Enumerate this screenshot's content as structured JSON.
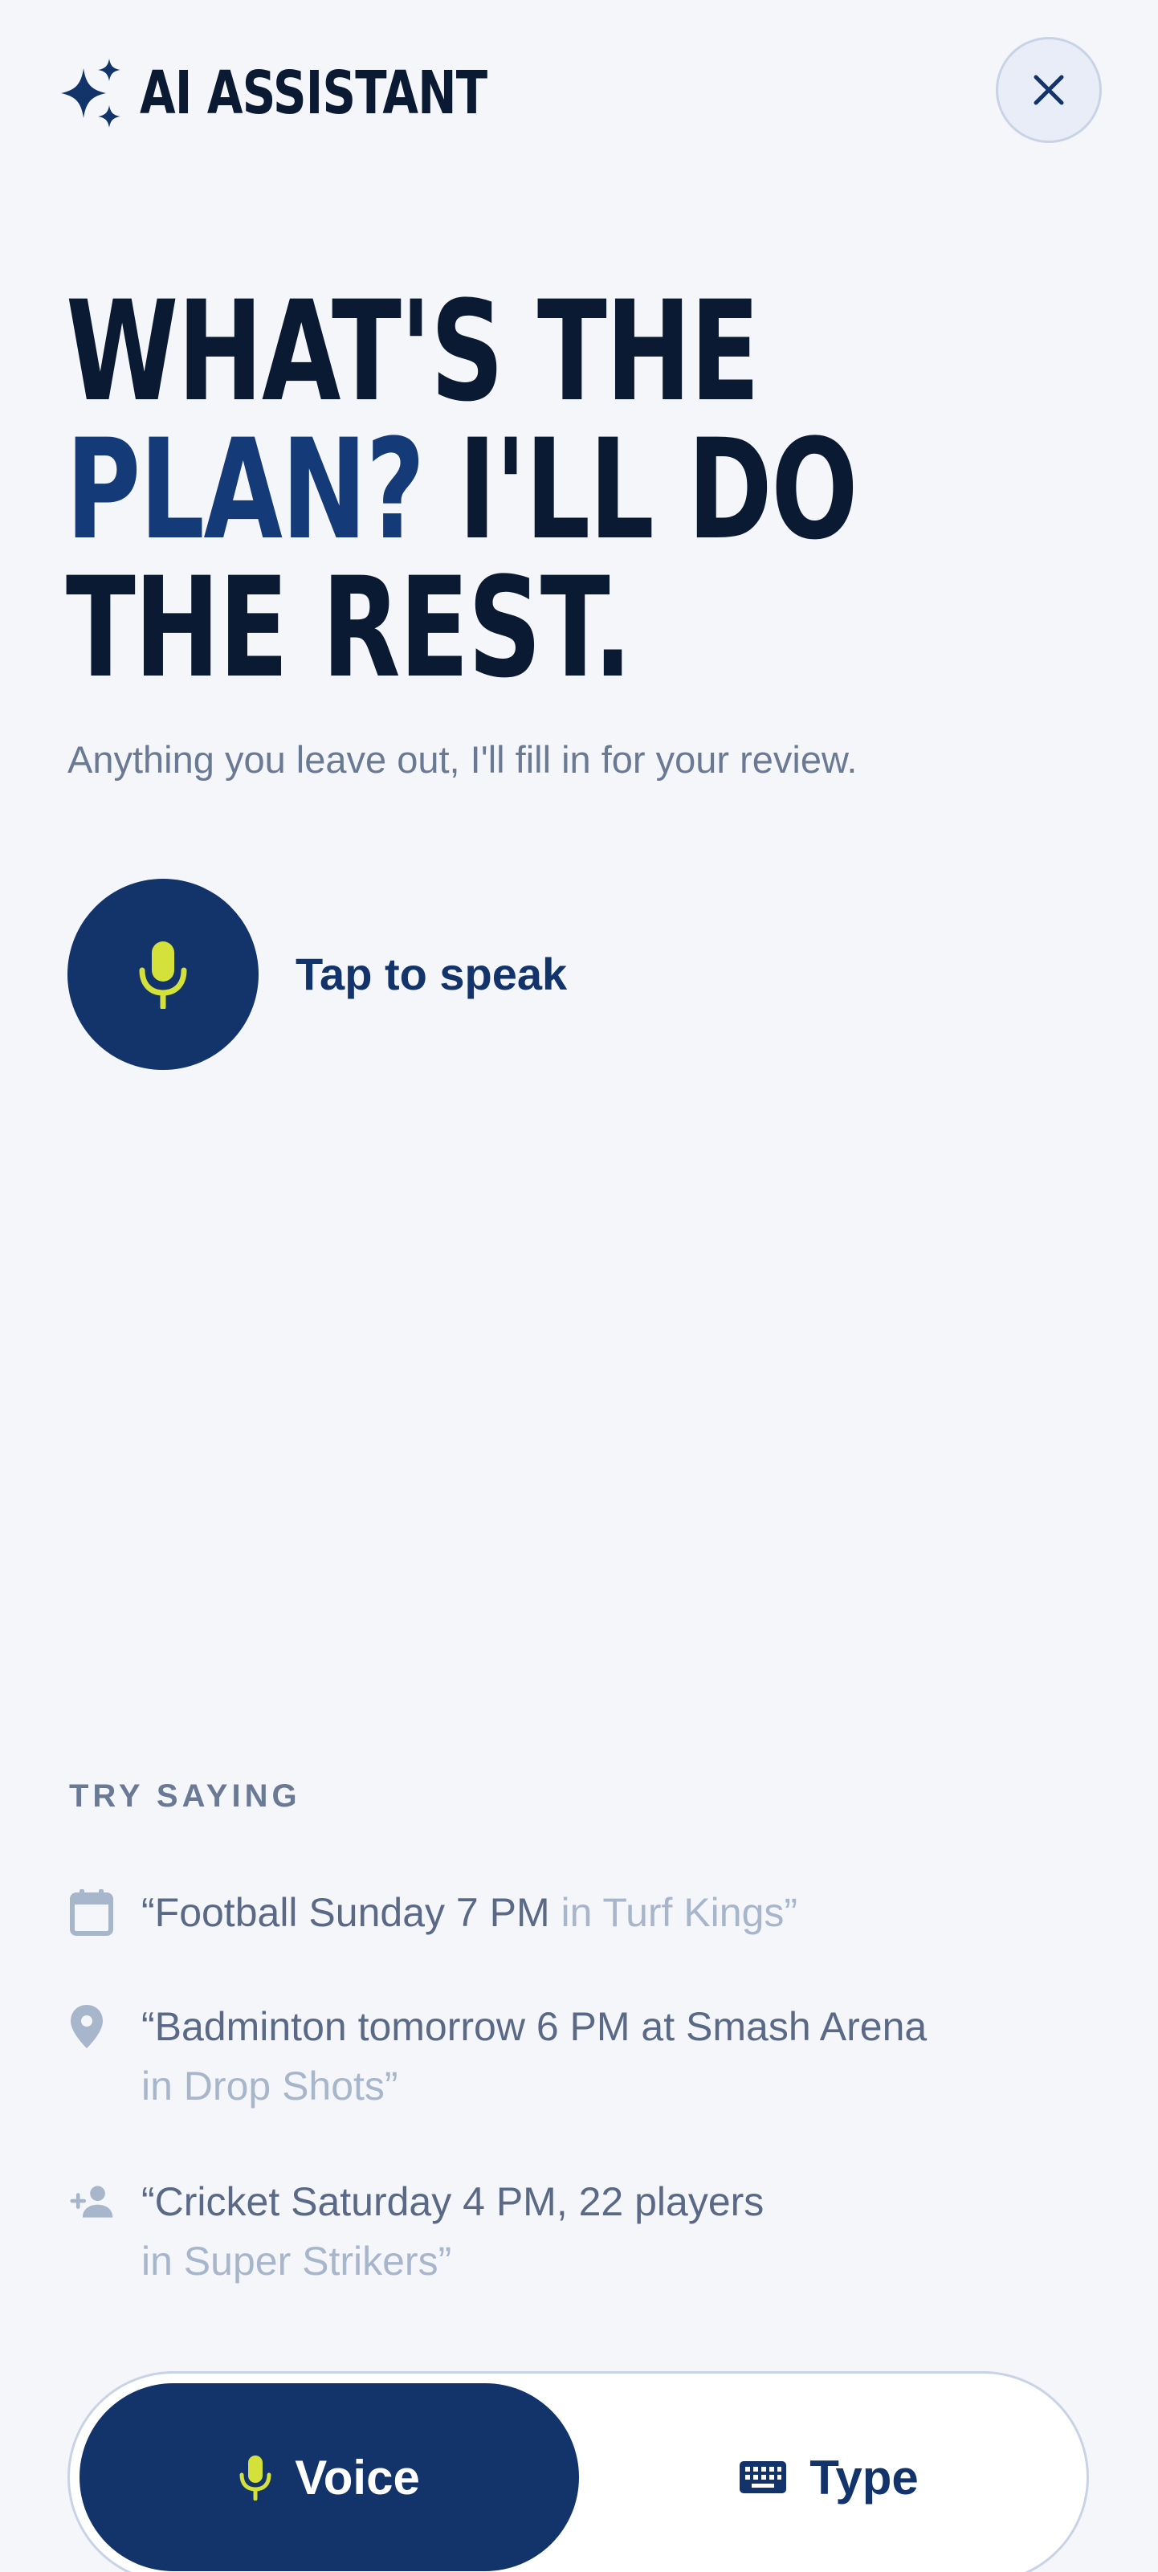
{
  "header": {
    "title": "AI ASSISTANT",
    "sparkle_icon": "sparkle-icon",
    "close_icon": "close-icon"
  },
  "hero": {
    "line1": "WHAT'S THE",
    "line2_accent": "PLAN?",
    "line2_rest": " I'LL DO",
    "line3": "THE REST.",
    "subtitle": "Anything you leave out, I'll fill in for your review."
  },
  "speak": {
    "label": "Tap to speak",
    "icon": "microphone-icon"
  },
  "try_saying": {
    "heading": "TRY SAYING",
    "examples": [
      {
        "icon": "calendar-icon",
        "main": "“Football Sunday 7 PM",
        "muted": " in Turf Kings”"
      },
      {
        "icon": "location-pin-icon",
        "main": "“Badminton tomorrow 6 PM at Smash Arena",
        "muted": "in Drop Shots”"
      },
      {
        "icon": "add-person-icon",
        "main": "“Cricket Saturday 4 PM, 22 players",
        "muted": "in Super Strikers”"
      }
    ]
  },
  "mode_toggle": {
    "voice_label": "Voice",
    "type_label": "Type",
    "selected": "Voice"
  },
  "colors": {
    "background": "#f4f6fa",
    "navy": "#12346b",
    "headline": "#0b1a33",
    "accent_lime": "#d4e13a",
    "muted_text": "#6b7a94",
    "light_muted": "#a8b6cc"
  }
}
